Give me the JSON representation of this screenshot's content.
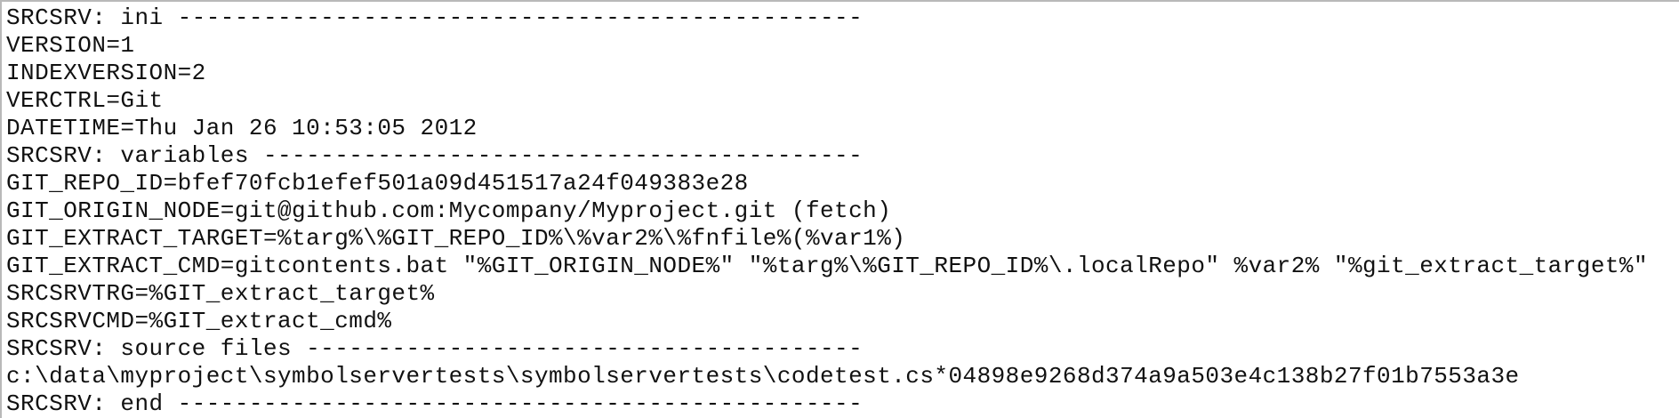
{
  "document": {
    "lines": [
      "SRCSRV: ini ------------------------------------------------",
      "VERSION=1",
      "INDEXVERSION=2",
      "VERCTRL=Git",
      "DATETIME=Thu Jan 26 10:53:05 2012",
      "SRCSRV: variables ------------------------------------------",
      "GIT_REPO_ID=bfef70fcb1efef501a09d451517a24f049383e28",
      "GIT_ORIGIN_NODE=git@github.com:Mycompany/Myproject.git (fetch)",
      "GIT_EXTRACT_TARGET=%targ%\\%GIT_REPO_ID%\\%var2%\\%fnfile%(%var1%)",
      "GIT_EXTRACT_CMD=gitcontents.bat \"%GIT_ORIGIN_NODE%\" \"%targ%\\%GIT_REPO_ID%\\.localRepo\" %var2% \"%git_extract_target%\"",
      "SRCSRVTRG=%GIT_extract_target%",
      "SRCSRVCMD=%GIT_extract_cmd%",
      "SRCSRV: source files ---------------------------------------",
      "c:\\data\\myproject\\symbolservertests\\symbolservertests\\codetest.cs*04898e9268d374a9a503e4c138b27f01b7553a3e",
      "SRCSRV: end ------------------------------------------------"
    ]
  }
}
